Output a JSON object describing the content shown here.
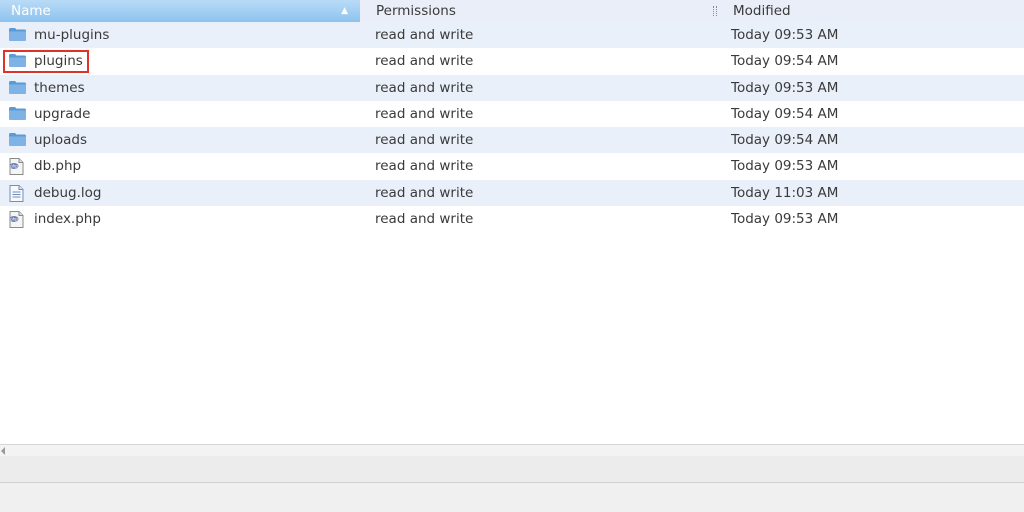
{
  "header": {
    "name_label": "Name",
    "permissions_label": "Permissions",
    "modified_label": "Modified"
  },
  "rows": [
    {
      "icon": "folder-icon",
      "name": "mu-plugins",
      "permissions": "read and write",
      "modified": "Today 09:53 AM"
    },
    {
      "icon": "folder-icon",
      "name": "plugins",
      "permissions": "read and write",
      "modified": "Today 09:54 AM"
    },
    {
      "icon": "folder-icon",
      "name": "themes",
      "permissions": "read and write",
      "modified": "Today 09:53 AM"
    },
    {
      "icon": "folder-icon",
      "name": "upgrade",
      "permissions": "read and write",
      "modified": "Today 09:54 AM"
    },
    {
      "icon": "folder-icon",
      "name": "uploads",
      "permissions": "read and write",
      "modified": "Today 09:54 AM"
    },
    {
      "icon": "php-file-icon",
      "name": "db.php",
      "permissions": "read and write",
      "modified": "Today 09:53 AM"
    },
    {
      "icon": "text-file-icon",
      "name": "debug.log",
      "permissions": "read and write",
      "modified": "Today 11:03 AM"
    },
    {
      "icon": "php-file-icon",
      "name": "index.php",
      "permissions": "read and write",
      "modified": "Today 09:53 AM"
    }
  ],
  "colors": {
    "header_active": "#8cc3ef",
    "row_alt": "#eaf0fa",
    "folder": "#5b9bd5",
    "highlight": "#e0312b"
  }
}
